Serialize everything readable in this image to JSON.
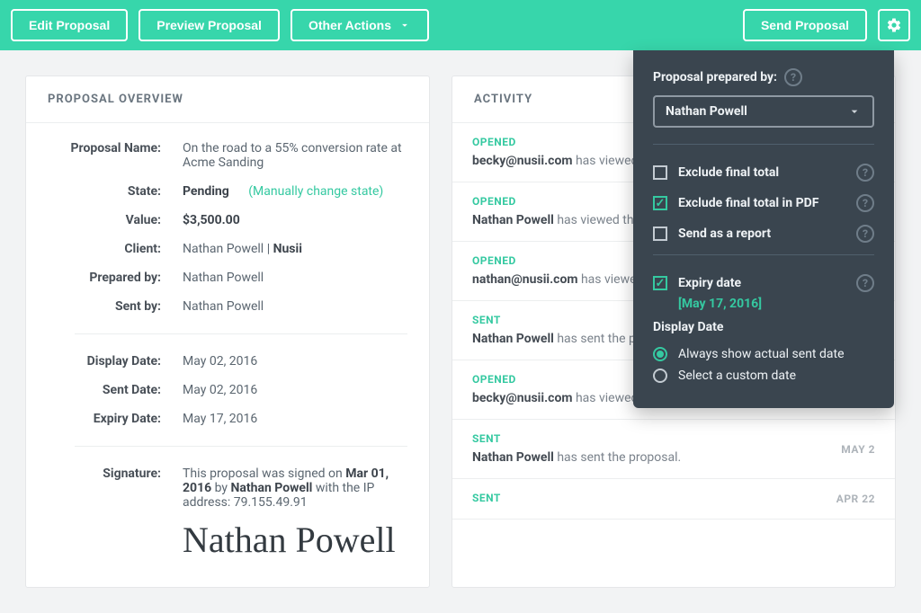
{
  "topbar": {
    "edit": "Edit Proposal",
    "preview": "Preview Proposal",
    "other": "Other Actions",
    "send": "Send Proposal"
  },
  "overview": {
    "title": "PROPOSAL OVERVIEW",
    "labels": {
      "name": "Proposal Name:",
      "state": "State:",
      "value": "Value:",
      "client": "Client:",
      "prepared": "Prepared by:",
      "sent": "Sent by:",
      "display_date": "Display Date:",
      "sent_date": "Sent Date:",
      "expiry_date": "Expiry Date:",
      "signature": "Signature:"
    },
    "values": {
      "name": "On the road to a 55% conversion rate at Acme Sanding",
      "state": "Pending",
      "state_link": "(Manually change state)",
      "value": "$3,500.00",
      "client_name": "Nathan Powell",
      "client_company": "Nusii",
      "prepared": "Nathan Powell",
      "sent": "Nathan Powell",
      "display_date": "May 02, 2016",
      "sent_date": "May 02, 2016",
      "expiry_date": "May 17, 2016",
      "sig_prefix": "This proposal was signed on ",
      "sig_date": "Mar 01, 2016",
      "sig_mid": " by ",
      "sig_name": "Nathan Powell",
      "sig_suffix": " with the IP address: 79.155.49.91",
      "signature_script": "Nathan Powell"
    }
  },
  "activity": {
    "title": "ACTIVITY",
    "items": [
      {
        "type": "OPENED",
        "who": "becky@nusii.com",
        "text": " has viewed the proposal.",
        "date": ""
      },
      {
        "type": "OPENED",
        "who": "Nathan Powell",
        "text": " has viewed the proposal.",
        "date": ""
      },
      {
        "type": "OPENED",
        "who": "nathan@nusii.com",
        "text": " has viewed the proposal.",
        "date": ""
      },
      {
        "type": "SENT",
        "who": "Nathan Powell",
        "text": " has sent the proposal.",
        "date": ""
      },
      {
        "type": "OPENED",
        "who": "becky@nusii.com",
        "text": " has viewed the proposal.",
        "date": ""
      },
      {
        "type": "SENT",
        "who": "Nathan Powell",
        "text": " has sent the proposal.",
        "date": "MAY 2"
      },
      {
        "type": "SENT",
        "who": "",
        "text": "",
        "date": "APR 22"
      }
    ]
  },
  "popover": {
    "prepared_label": "Proposal prepared by:",
    "prepared_value": "Nathan Powell",
    "opts": {
      "exclude_total": {
        "label": "Exclude final total",
        "checked": false
      },
      "exclude_pdf": {
        "label": "Exclude final total in PDF",
        "checked": true
      },
      "send_report": {
        "label": "Send as a report",
        "checked": false
      },
      "expiry": {
        "label": "Expiry date",
        "checked": true,
        "value": "[May 17, 2016]"
      }
    },
    "display_date_heading": "Display Date",
    "radio": {
      "actual": "Always show actual sent date",
      "custom": "Select a custom date",
      "selected": "actual"
    }
  }
}
